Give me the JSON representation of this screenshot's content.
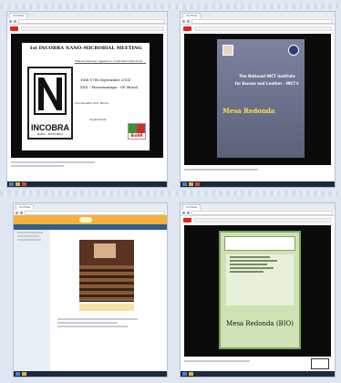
{
  "browser_tab_labels": [
    "YouTube",
    "YouTube",
    "YouTube",
    "YouTube"
  ],
  "q1": {
    "slide_title": "1st INCOBRA NANO-MICROBIAL MEETING",
    "subtitle": "Nanotechnology applied to Controlled Infections",
    "dates": "16th-17th September 2014",
    "place": "XXX - Pirassununga - SP, Brasil",
    "coord_label": "Coordenador Prof. Nome",
    "org_label": "Organização",
    "logo_text": "INCOBRA",
    "logo_subtext": "NANO - MICROBIAL",
    "logo2_text": "BioNR"
  },
  "q2": {
    "title_lines": [
      "The National INCT Institute",
      "for Excess and Leather - INCT®"
    ],
    "yellow_text": "Mesa Redonda"
  },
  "q4": {
    "signature_text": "Mesa Redonda (BIO)"
  },
  "colors": {
    "youtube_red": "#e62117",
    "taskbar": "#1d2a3c",
    "q2_bg": "#6a6f88",
    "q3_accent": "#f4b23b"
  }
}
